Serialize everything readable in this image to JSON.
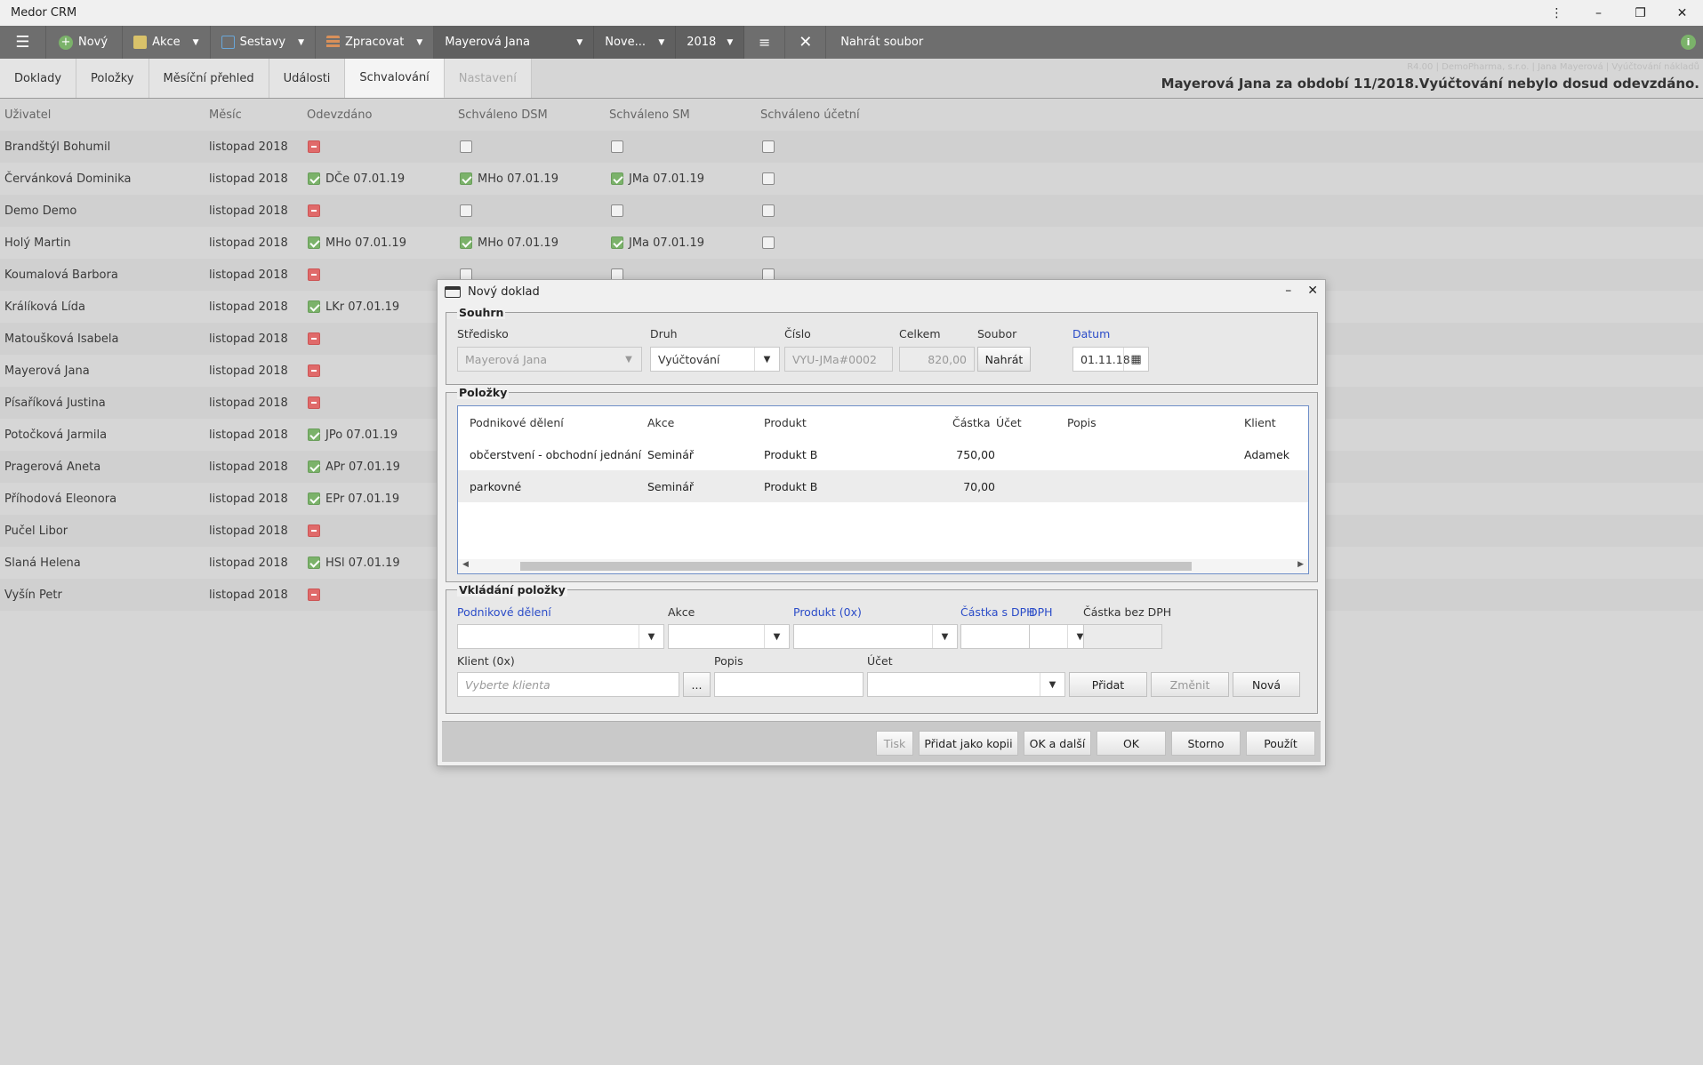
{
  "window": {
    "title": "Medor CRM",
    "minimize": "–",
    "restore": "❐",
    "close": "✕",
    "menu": "⋮"
  },
  "toolbar": {
    "new_label": "Nový",
    "actions_label": "Akce",
    "reports_label": "Sestavy",
    "process_label": "Zpracovat",
    "user_select": "Mayerová Jana",
    "month_select": "Nove...",
    "year_select": "2018",
    "upload_label": "Nahrát soubor",
    "status_icon": "i"
  },
  "tabs": [
    {
      "label": "Doklady"
    },
    {
      "label": "Položky"
    },
    {
      "label": "Měsíční přehled"
    },
    {
      "label": "Události"
    },
    {
      "label": "Schvalování"
    },
    {
      "label": "Nastavení"
    }
  ],
  "header": {
    "meta": "R4.00 | DemoPharma, s.r.o. | Jana Mayerová | Vyúčtování nákladů",
    "status": "Mayerová Jana za období 11/2018.Vyúčtování nebylo dosud odevzdáno."
  },
  "grid": {
    "columns": [
      "Uživatel",
      "Měsíc",
      "Odevzdáno",
      "Schváleno DSM",
      "Schváleno SM",
      "Schváleno účetní"
    ],
    "rows": [
      {
        "user": "Brandštýl Bohumil",
        "month": "listopad 2018",
        "submitted": "minus",
        "submitted_text": "",
        "dsm": "empty",
        "dsm_text": "",
        "sm": "empty",
        "sm_text": "",
        "acc": "empty"
      },
      {
        "user": "Červánková Dominika",
        "month": "listopad 2018",
        "submitted": "checked",
        "submitted_text": "DČe 07.01.19",
        "dsm": "checked",
        "dsm_text": "MHo 07.01.19",
        "sm": "checked",
        "sm_text": "JMa 07.01.19",
        "acc": "empty"
      },
      {
        "user": "Demo Demo",
        "month": "listopad 2018",
        "submitted": "minus",
        "submitted_text": "",
        "dsm": "empty",
        "dsm_text": "",
        "sm": "empty",
        "sm_text": "",
        "acc": "empty"
      },
      {
        "user": "Holý Martin",
        "month": "listopad 2018",
        "submitted": "checked",
        "submitted_text": "MHo 07.01.19",
        "dsm": "checked",
        "dsm_text": "MHo 07.01.19",
        "sm": "checked",
        "sm_text": "JMa 07.01.19",
        "acc": "empty"
      },
      {
        "user": "Koumalová Barbora",
        "month": "listopad 2018",
        "submitted": "minus",
        "submitted_text": "",
        "dsm": "empty",
        "dsm_text": "",
        "sm": "empty",
        "sm_text": "",
        "acc": "empty"
      },
      {
        "user": "Králíková Lída",
        "month": "listopad 2018",
        "submitted": "checked",
        "submitted_text": "LKr 07.01.19",
        "dsm": "none",
        "dsm_text": "",
        "sm": "none",
        "sm_text": "",
        "acc": "none"
      },
      {
        "user": "Matoušková Isabela",
        "month": "listopad 2018",
        "submitted": "minus",
        "submitted_text": "",
        "dsm": "none",
        "dsm_text": "",
        "sm": "none",
        "sm_text": "",
        "acc": "none"
      },
      {
        "user": "Mayerová Jana",
        "month": "listopad 2018",
        "submitted": "minus",
        "submitted_text": "",
        "dsm": "none",
        "dsm_text": "",
        "sm": "none",
        "sm_text": "",
        "acc": "none"
      },
      {
        "user": "Písaříková Justina",
        "month": "listopad 2018",
        "submitted": "minus",
        "submitted_text": "",
        "dsm": "none",
        "dsm_text": "",
        "sm": "none",
        "sm_text": "",
        "acc": "none"
      },
      {
        "user": "Potočková Jarmila",
        "month": "listopad 2018",
        "submitted": "checked",
        "submitted_text": "JPo 07.01.19",
        "dsm": "none",
        "dsm_text": "",
        "sm": "none",
        "sm_text": "",
        "acc": "none"
      },
      {
        "user": "Pragerová Aneta",
        "month": "listopad 2018",
        "submitted": "checked",
        "submitted_text": "APr 07.01.19",
        "dsm": "none",
        "dsm_text": "",
        "sm": "none",
        "sm_text": "",
        "acc": "none"
      },
      {
        "user": "Příhodová Eleonora",
        "month": "listopad 2018",
        "submitted": "checked",
        "submitted_text": "EPr 07.01.19",
        "dsm": "none",
        "dsm_text": "",
        "sm": "none",
        "sm_text": "",
        "acc": "none"
      },
      {
        "user": "Pučel Libor",
        "month": "listopad 2018",
        "submitted": "minus",
        "submitted_text": "",
        "dsm": "none",
        "dsm_text": "",
        "sm": "none",
        "sm_text": "",
        "acc": "none"
      },
      {
        "user": "Slaná Helena",
        "month": "listopad 2018",
        "submitted": "checked",
        "submitted_text": "HSl 07.01.19",
        "dsm": "none",
        "dsm_text": "",
        "sm": "none",
        "sm_text": "",
        "acc": "none"
      },
      {
        "user": "Vyšín Petr",
        "month": "listopad 2018",
        "submitted": "minus",
        "submitted_text": "",
        "dsm": "none",
        "dsm_text": "",
        "sm": "none",
        "sm_text": "",
        "acc": "none"
      }
    ]
  },
  "dialog": {
    "title": "Nový doklad",
    "minimize": "–",
    "close": "✕",
    "summary": {
      "legend": "Souhrn",
      "center_label": "Středisko",
      "center_value": "Mayerová Jana",
      "type_label": "Druh",
      "type_value": "Vyúčtování",
      "number_label": "Číslo",
      "number_value": "VYU-JMa#0002",
      "total_label": "Celkem",
      "total_value": "820,00",
      "file_label": "Soubor",
      "upload_button": "Nahrát",
      "date_label": "Datum",
      "date_value": "01.11.18"
    },
    "items": {
      "legend": "Položky",
      "columns": [
        "Podnikové dělení",
        "Akce",
        "Produkt",
        "Částka",
        "Účet",
        "Popis",
        "Klient"
      ],
      "rows": [
        {
          "division": "občerstvení - obchodní jednání",
          "action": "Seminář",
          "product": "Produkt B",
          "amount": "750,00",
          "account": "",
          "description": "",
          "client": "Adamek"
        },
        {
          "division": "parkovné",
          "action": "Seminář",
          "product": "Produkt B",
          "amount": "70,00",
          "account": "",
          "description": "",
          "client": ""
        }
      ]
    },
    "entry": {
      "legend": "Vkládání položky",
      "division_label": "Podnikové dělení",
      "action_label": "Akce",
      "product_label": "Produkt (0x)",
      "amount_vat_label": "Částka s DPH",
      "vat_label": "DPH",
      "amount_novat_label": "Částka bez DPH",
      "client_label": "Klient (0x)",
      "client_placeholder": "Vyberte klienta",
      "ellipsis": "...",
      "description_label": "Popis",
      "account_label": "Účet",
      "add_button": "Přidat",
      "change_button": "Změnit",
      "new_button": "Nová"
    },
    "footer": {
      "print": "Tisk",
      "add_copy": "Přidat jako kopii",
      "ok_next": "OK a další",
      "ok": "OK",
      "cancel": "Storno",
      "apply": "Použít"
    }
  }
}
